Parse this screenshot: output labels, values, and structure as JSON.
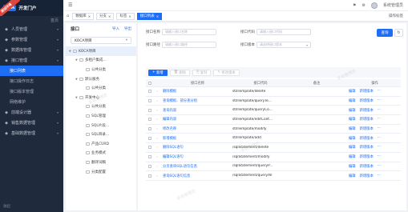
{
  "app": {
    "logo": "KCA",
    "title": "开发门户",
    "ribbon": "测试环境"
  },
  "sidebar": {
    "home": "首页",
    "items": [
      {
        "label": "人员管理",
        "icon": "user-icon"
      },
      {
        "label": "参数管理",
        "icon": "param-icon"
      },
      {
        "label": "数据库管理",
        "icon": "database-icon"
      },
      {
        "label": "接口管理",
        "icon": "api-icon"
      }
    ],
    "subitems": [
      "接口列表",
      "接口操作日志",
      "接口版本管理",
      "网络维护"
    ],
    "items2": [
      {
        "label": "前端设计器",
        "icon": "design-icon"
      },
      {
        "label": "销售数据管理",
        "icon": "sales-icon"
      },
      {
        "label": "基础数据管理",
        "icon": "base-icon"
      }
    ],
    "footer": "收起"
  },
  "header": {
    "user": "系统管理员"
  },
  "tabs": [
    {
      "label": "数据库",
      "active": false
    },
    {
      "label": "分支",
      "active": false
    },
    {
      "label": "标签",
      "active": false
    },
    {
      "label": "接口列表",
      "active": true
    }
  ],
  "tabs_more": "操作标签",
  "tree": {
    "title": "接口",
    "import": "导入",
    "export": "导出",
    "project": "KOCA项目",
    "nodes": [
      {
        "label": "KOCA项目",
        "level": 0,
        "sel": true,
        "tog": "▼"
      },
      {
        "label": "多租户集成...",
        "level": 1,
        "tog": "▼"
      },
      {
        "label": "公共分类",
        "level": 2,
        "tog": ""
      },
      {
        "label": "默认服务",
        "level": 1,
        "tog": "▼"
      },
      {
        "label": "公共分类",
        "level": 2,
        "tog": ""
      },
      {
        "label": "开发中心",
        "level": 1,
        "tog": "▼"
      },
      {
        "label": "公共分类",
        "level": 2,
        "tog": ""
      },
      {
        "label": "SQL管理",
        "level": 2,
        "tog": ""
      },
      {
        "label": "SQL片段...",
        "level": 2,
        "tog": ""
      },
      {
        "label": "SQL目录...",
        "level": 2,
        "tog": ""
      },
      {
        "label": "产品CURD",
        "level": 2,
        "tog": ""
      },
      {
        "label": "业务模式",
        "level": 2,
        "tog": ""
      },
      {
        "label": "翻译词稿",
        "level": 2,
        "tog": ""
      },
      {
        "label": "分类配置",
        "level": 2,
        "tog": ""
      }
    ]
  },
  "search": {
    "name_label": "接口名称",
    "name_placeholder": "请输入接口名称",
    "code_label": "接口代码",
    "code_placeholder": "请输入接口代码",
    "path_label": "接口路径",
    "path_placeholder": "请输入接口路径",
    "version_label": "接口版本",
    "version_placeholder": "请选择接口版本",
    "query": "查询"
  },
  "toolbar": {
    "add": "新增",
    "delete": "删除",
    "copy": "复制",
    "version": "修改版本"
  },
  "table": {
    "headers": [
      "接口名称",
      "接口代码",
      "备注",
      "操作"
    ],
    "rows": [
      {
        "name": "删除模板",
        "code": "stdTemplate/delete",
        "note": "",
        "ops": [
          "编辑",
          "新增版本",
          "···"
        ]
      },
      {
        "name": "查询模板、部分查分组",
        "code": "stdTemplate/queryTe...",
        "note": "",
        "ops": [
          "编辑",
          "新增版本",
          "···"
        ]
      },
      {
        "name": "查询内容",
        "code": "stdTemplate/queryCo...",
        "note": "",
        "ops": [
          "编辑",
          "新增版本",
          "···"
        ]
      },
      {
        "name": "编辑内容",
        "code": "stdTemplate/editCont...",
        "note": "",
        "ops": [
          "编辑",
          "新增版本",
          "···"
        ]
      },
      {
        "name": "修改名称",
        "code": "stdTemplate/modify",
        "note": "",
        "ops": [
          "编辑",
          "新增版本",
          "···"
        ]
      },
      {
        "name": "新增模板",
        "code": "stdTemplate/add",
        "note": "",
        "ops": [
          "编辑",
          "新增版本",
          "···"
        ]
      },
      {
        "name": "删除SQL语句",
        "code": "/sqlStatement/delete",
        "note": "",
        "ops": [
          "编辑",
          "新增版本",
          "···"
        ]
      },
      {
        "name": "编辑SQL语句",
        "code": "/sqlStatement/modify",
        "note": "",
        "ops": [
          "编辑",
          "新增版本",
          "···"
        ]
      },
      {
        "name": "分页查询SQL语句信息",
        "code": "/sqlStatement/queryP...",
        "note": "",
        "ops": [
          "编辑",
          "新增版本",
          "···"
        ]
      },
      {
        "name": "查询SQL语句信息",
        "code": "/sqlStatement/queryAll",
        "note": "",
        "ops": [
          "编辑",
          "新增版本",
          "···"
        ]
      }
    ]
  },
  "watermark": "系统管理员",
  "colors": {
    "primary": "#1e6ef5",
    "sidebar": "#1f2a3c",
    "ribbon": "#e0463e"
  }
}
